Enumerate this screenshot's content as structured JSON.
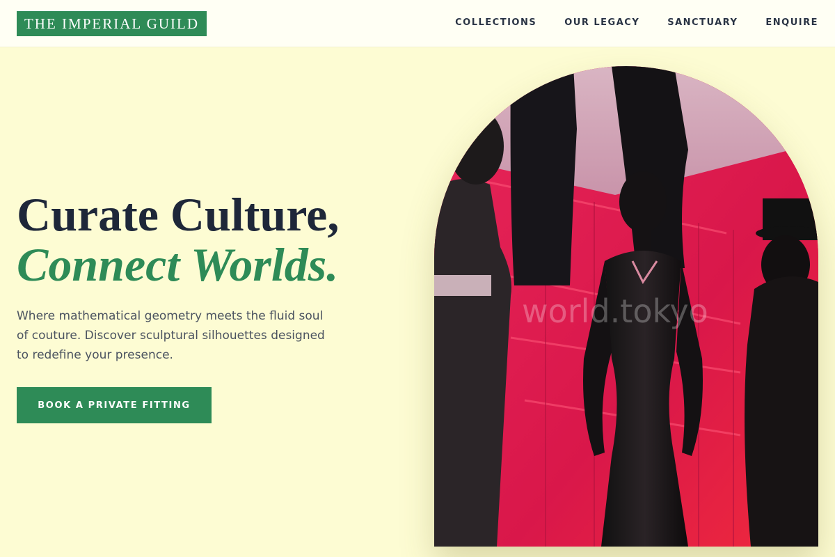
{
  "header": {
    "logo": "THE IMPERIAL GUILD",
    "nav": [
      "COLLECTIONS",
      "OUR LEGACY",
      "SANCTUARY",
      "ENQUIRE"
    ]
  },
  "hero": {
    "headline_line1": "Curate Culture,",
    "headline_line2": "Connect Worlds.",
    "lede": "Where mathematical geometry meets the fluid soul of couture. Discover sculptural silhouettes designed to redefine your presence.",
    "cta_label": "BOOK A PRIVATE FITTING",
    "image_watermark": "world.tokyo"
  },
  "colors": {
    "background": "#fdfcd3",
    "header_background": "#fffff4",
    "accent_green": "#2e8b57",
    "headline_dark": "#1e2739",
    "body_text": "#4b5360"
  }
}
